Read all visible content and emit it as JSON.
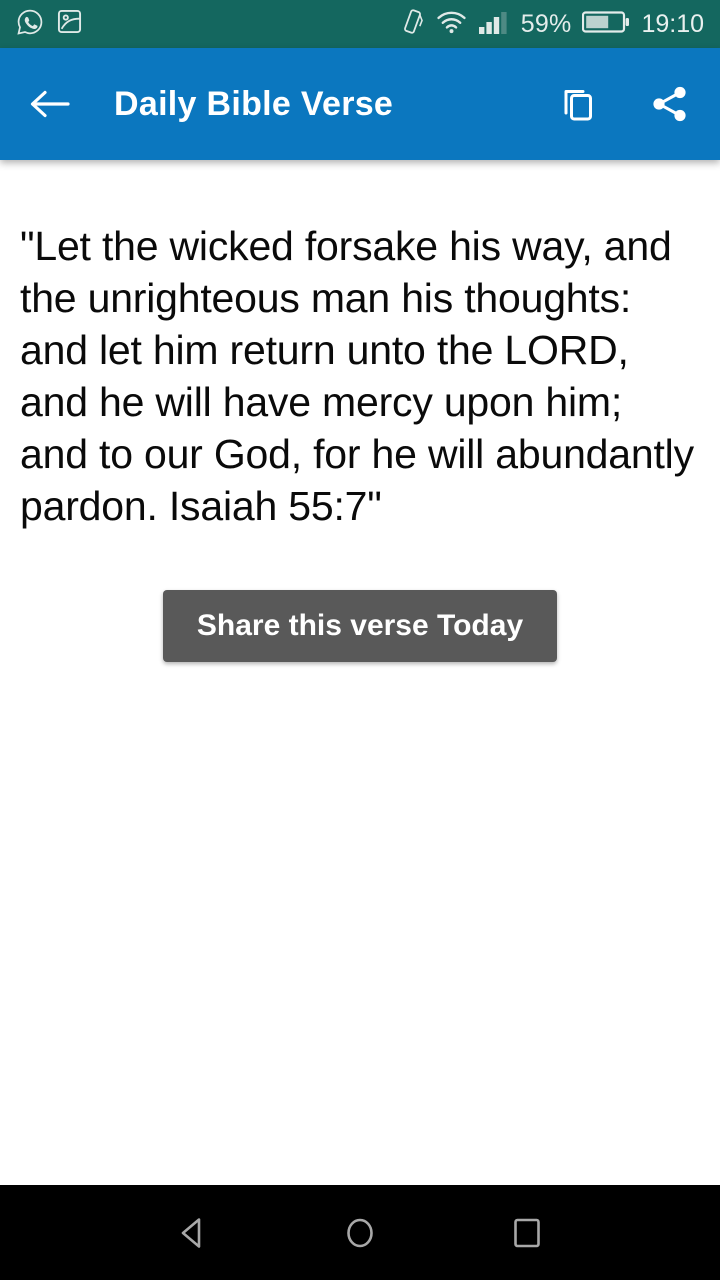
{
  "status_bar": {
    "background_color": "#14675f",
    "left_icons": [
      {
        "name": "whatsapp-icon",
        "label": "WhatsApp"
      },
      {
        "name": "screenshot-image-icon",
        "label": "Screenshot"
      }
    ],
    "right_icons": [
      {
        "name": "vibrate-icon",
        "label": "Vibrate"
      },
      {
        "name": "wifi-icon",
        "label": "Wi-Fi"
      },
      {
        "name": "signal-bars-icon",
        "label": "Signal"
      }
    ],
    "battery_percent": "59%",
    "battery_level": 59,
    "time": "19:10"
  },
  "app_bar": {
    "background_color": "#0b77bf",
    "title": "Daily Bible Verse",
    "back_icon": "arrow-left-icon",
    "copy_icon": "copy-icon",
    "share_icon": "share-icon"
  },
  "main": {
    "verse_text": "\"Let the wicked forsake his way, and the unrighteous man his thoughts: and let him return unto the LORD, and he will have mercy upon him; and to our God, for he will abundantly pardon. Isaiah 55:7\"",
    "share_button_label": "Share this verse Today",
    "share_button_color": "#595959"
  },
  "nav_bar": {
    "background_color": "#000000",
    "buttons": [
      {
        "name": "nav-back-button",
        "icon": "triangle-left-icon"
      },
      {
        "name": "nav-home-button",
        "icon": "circle-icon"
      },
      {
        "name": "nav-recents-button",
        "icon": "square-icon"
      }
    ]
  }
}
